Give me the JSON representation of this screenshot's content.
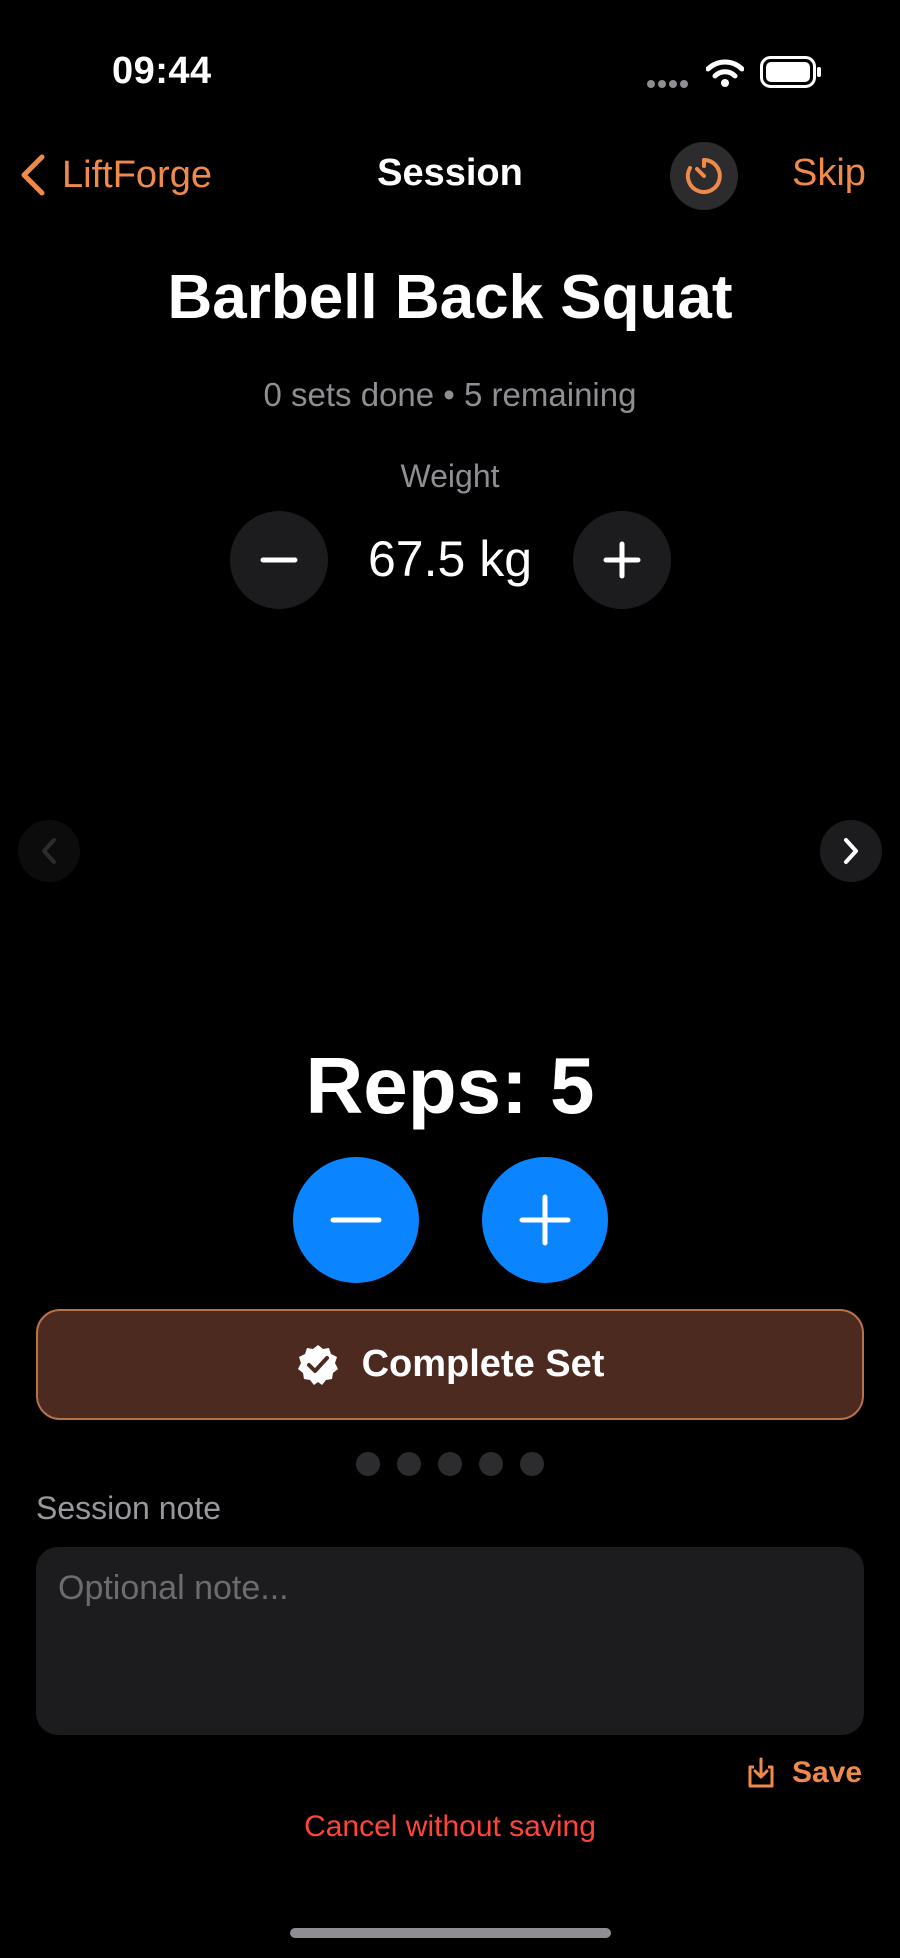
{
  "status_bar": {
    "time": "09:44"
  },
  "nav": {
    "back_label": "LiftForge",
    "title": "Session",
    "skip_label": "Skip"
  },
  "exercise": {
    "name": "Barbell Back Squat",
    "progress": "0 sets done • 5 remaining",
    "weight_label": "Weight",
    "weight_value": "67.5 kg",
    "reps_text": "Reps: 5"
  },
  "actions": {
    "complete_set_label": "Complete Set"
  },
  "pager": {
    "total_sets": 5,
    "completed_sets": 0
  },
  "note": {
    "label": "Session note",
    "placeholder": "Optional note..."
  },
  "footer": {
    "save_label": "Save",
    "cancel_label": "Cancel without saving"
  },
  "colors": {
    "accent": "#f08a4b",
    "blue": "#0a84ff",
    "destructive": "#ff453a",
    "complete_bg": "#4c2a1f"
  },
  "icons": [
    "chevron-left-icon",
    "timer-icon",
    "minus-icon",
    "plus-icon",
    "chevron-right-icon",
    "checkmark-seal-icon",
    "save-tray-icon"
  ]
}
